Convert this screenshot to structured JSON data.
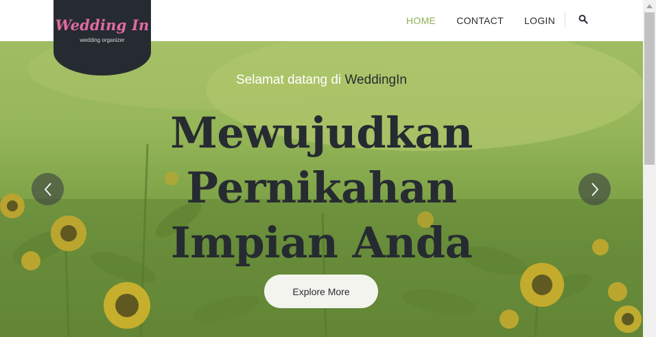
{
  "logo": {
    "title": "Wedding In",
    "subtitle": "wedding organizer"
  },
  "nav": {
    "items": [
      {
        "label": "HOME",
        "active": true
      },
      {
        "label": "CONTACT",
        "active": false
      },
      {
        "label": "LOGIN",
        "active": false
      }
    ],
    "search_icon": "search-icon"
  },
  "hero": {
    "greeting_prefix": "Selamat datang di",
    "greeting_brand": "WeddingIn",
    "headline_lines": [
      "Mewujudkan",
      "Pernikahan",
      "Impian Anda"
    ],
    "cta_label": "Explore More",
    "prev_icon": "chevron-left-icon",
    "next_icon": "chevron-right-icon"
  },
  "colors": {
    "accent": "#8fae52",
    "dark": "#262b31",
    "logo_pink": "#e06aa2"
  }
}
